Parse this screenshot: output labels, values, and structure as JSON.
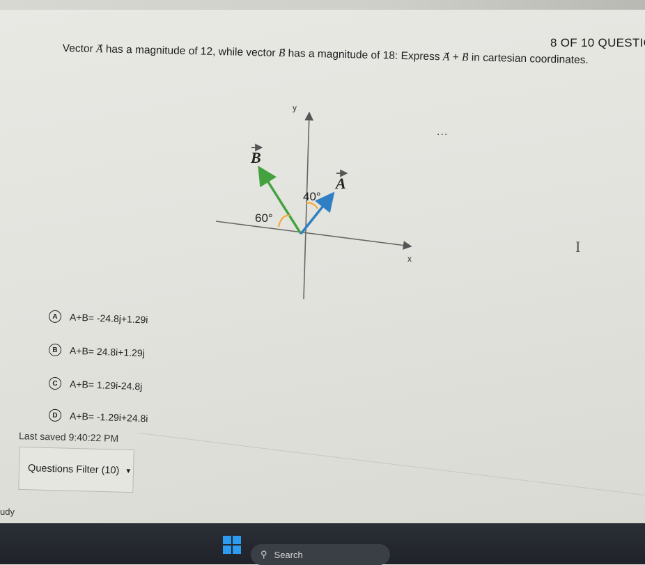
{
  "header": {
    "counter": "8 OF 10 QUESTIC"
  },
  "question": {
    "p1": "Vector ",
    "vA": "A",
    "p2": "⃗ has a magnitude of 12, while vector ",
    "vB": "B",
    "p3": "⃗ has a magnitude of 18: Express ",
    "vA2": "A",
    "p4": "⃗ + ",
    "vB2": "B",
    "p5": "⃗ in cartesian coordinates."
  },
  "more_icon": "...",
  "text_cursor": "I",
  "figure": {
    "y_label": "y",
    "x_label": "x",
    "vec_b_label": "B",
    "vec_a_label": "A",
    "angle_a": "40°",
    "angle_b": "60°",
    "colors": {
      "vector_b": "#43a23f",
      "vector_a": "#2f7fc4",
      "angle_arc": "#f2a93b"
    }
  },
  "options": [
    {
      "badge": "A",
      "text": "A+B= -24.8j+1.29i"
    },
    {
      "badge": "B",
      "text": "A+B= 24.8i+1.29j"
    },
    {
      "badge": "C",
      "text": "A+B= 1.29i-24.8j"
    },
    {
      "badge": "D",
      "text": "A+B= -1.29i+24.8i"
    }
  ],
  "footer": {
    "last_saved": "Last saved 9:40:22 PM",
    "filter_label": "Questions Filter (10)",
    "filter_caret": "▼",
    "partial_text": "udy"
  },
  "taskbar": {
    "search_label": "Search",
    "search_icon": "⚲"
  }
}
